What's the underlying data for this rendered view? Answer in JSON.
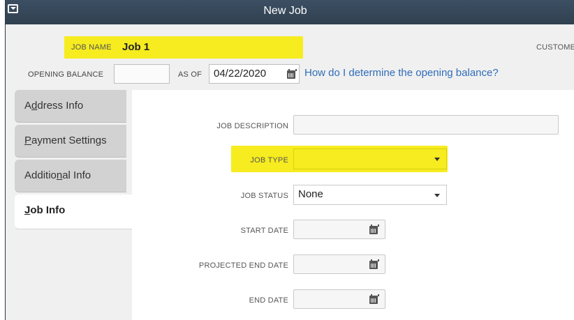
{
  "window": {
    "title": "New Job"
  },
  "header": {
    "job_name_label": "JOB NAME",
    "job_name_value": "Job 1",
    "customer_label": "CUSTOMER",
    "opening_balance_label": "OPENING BALANCE",
    "opening_balance_value": "",
    "as_of_label": "AS OF",
    "as_of_value": "04/22/2020",
    "help_link": "How do I determine the opening balance?"
  },
  "tabs": [
    {
      "label": "Address Info",
      "underline": "d",
      "active": false
    },
    {
      "label": "Payment Settings",
      "underline": "P",
      "active": false
    },
    {
      "label": "Additional Info",
      "underline": "n",
      "active": false
    },
    {
      "label": "Job Info",
      "underline": "J",
      "active": true
    }
  ],
  "job_info": {
    "job_description_label": "JOB DESCRIPTION",
    "job_description_value": "",
    "job_type_label": "JOB TYPE",
    "job_type_value": "",
    "job_status_label": "JOB STATUS",
    "job_status_value": "None",
    "start_date_label": "START DATE",
    "projected_end_date_label": "PROJECTED END DATE",
    "end_date_label": "END DATE"
  },
  "colors": {
    "highlight": "#f6ec1f",
    "link": "#2f6db8",
    "titlebar": "#34465a"
  },
  "icons": {
    "date_picker": "calendar-icon",
    "dropdown": "chevron-down-icon",
    "window_menu": "window-menu-icon"
  }
}
